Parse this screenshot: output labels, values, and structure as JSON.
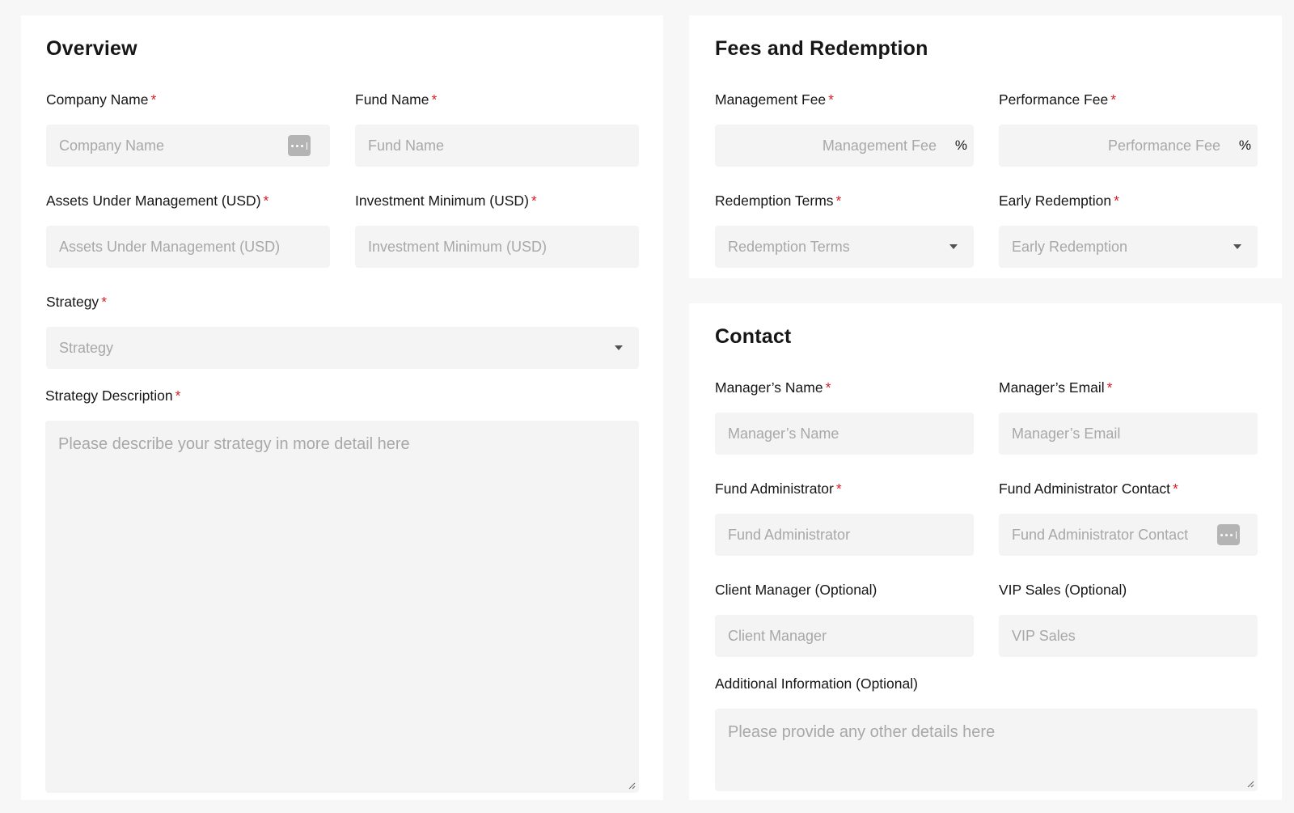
{
  "overview": {
    "title": "Overview",
    "company_name": {
      "label": "Company Name",
      "required": "*",
      "placeholder": "Company Name"
    },
    "fund_name": {
      "label": "Fund Name",
      "required": "*",
      "placeholder": "Fund Name"
    },
    "aum": {
      "label": "Assets Under Management (USD)",
      "required": "*",
      "placeholder": "Assets Under Management (USD)"
    },
    "investment_min": {
      "label": "Investment Minimum (USD)",
      "required": "*",
      "placeholder": "Investment Minimum (USD)"
    },
    "strategy": {
      "label": "Strategy",
      "required": "*",
      "placeholder": "Strategy"
    },
    "strategy_description": {
      "label": "Strategy Description",
      "required": "*",
      "placeholder": "Please describe your strategy in more detail here"
    }
  },
  "fees": {
    "title": "Fees and Redemption",
    "management_fee": {
      "label": "Management Fee",
      "required": "*",
      "placeholder": "Management Fee",
      "suffix": "%"
    },
    "performance_fee": {
      "label": "Performance Fee",
      "required": "*",
      "placeholder": "Performance Fee",
      "suffix": "%"
    },
    "redemption_terms": {
      "label": "Redemption Terms",
      "required": "*",
      "placeholder": "Redemption Terms"
    },
    "early_redemption": {
      "label": "Early Redemption",
      "required": "*",
      "placeholder": "Early Redemption"
    }
  },
  "contact": {
    "title": "Contact",
    "manager_name": {
      "label": "Manager’s Name",
      "required": "*",
      "placeholder": "Manager’s Name"
    },
    "manager_email": {
      "label": "Manager’s Email",
      "required": "*",
      "placeholder": "Manager’s Email"
    },
    "fund_admin": {
      "label": "Fund Administrator",
      "required": "*",
      "placeholder": "Fund Administrator"
    },
    "fund_admin_contact": {
      "label": "Fund Administrator Contact",
      "required": "*",
      "placeholder": "Fund Administrator Contact"
    },
    "client_manager": {
      "label": "Client Manager (Optional)",
      "placeholder": "Client Manager"
    },
    "vip_sales": {
      "label": "VIP Sales (Optional)",
      "placeholder": "VIP Sales"
    },
    "additional_info": {
      "label": "Additional Information (Optional)",
      "placeholder": "Please provide any other details here"
    }
  },
  "icons": {
    "password_manager": "more-dots-icon",
    "dropdown": "caret-down-icon",
    "resize": "resize-handle-icon"
  },
  "colors": {
    "required": "#da1e28",
    "field_bg": "#f4f4f4",
    "placeholder": "#a8a8a8",
    "page_bg": "#f7f7f7"
  }
}
